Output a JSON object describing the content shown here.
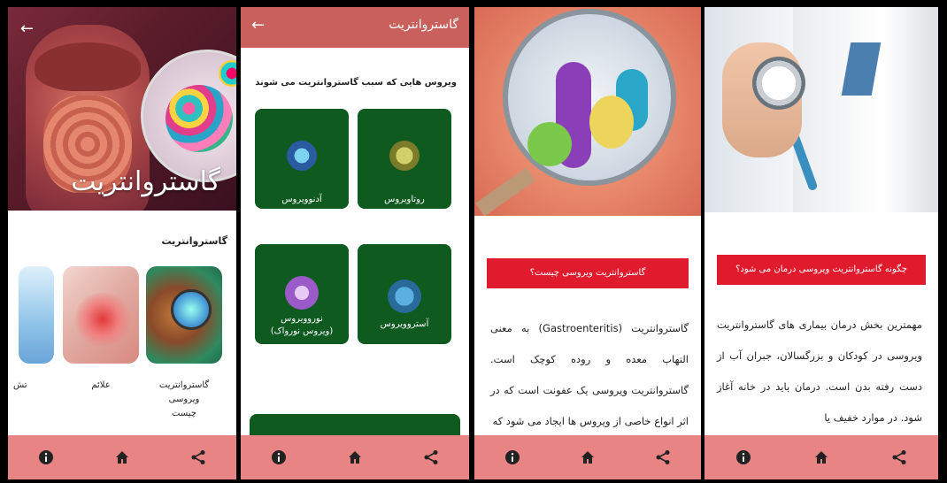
{
  "screen1": {
    "hero_title": "گاستروانتریت",
    "section_title": "گاستروانتریت",
    "cards": [
      {
        "label_line1": "گاستروانتریت ویروسی",
        "label_line2": "چیست"
      },
      {
        "label_line1": "علائم",
        "label_line2": ""
      },
      {
        "label_line1": "تش",
        "label_line2": ""
      }
    ]
  },
  "screen2": {
    "title": "گاستروانتریت",
    "subtitle": "ویروس هایی که سبب گاستروانتریت می شوند",
    "viruses": [
      {
        "label": "روتاویروس"
      },
      {
        "label": "آدنوویروس"
      },
      {
        "label": "آستروویروس"
      },
      {
        "label_line1": "نوروویروس",
        "label_line2": "(ویروس نورواک)"
      }
    ]
  },
  "screen3": {
    "heading": "گاستروانتریت ویروسی چیست؟",
    "paragraph": "گاستروانتریت (Gastroenteritis) به معنی التهاب معده و روده کوچک است. گاستروانتریت ویروسی یک عفونت است که در اثر انواع خاصی از ویروس ها ایجاد می شود که"
  },
  "screen4": {
    "heading": "چگونه گاستروانتریت ویروسی درمان می شود؟",
    "paragraph": "مهمترین بخش درمان بیماری های گاستروانتریت ویروسی در کودکان و بزرگسالان، جبران آب از دست رفته بدن است. درمان باید در خانه آغاز شود. در موارد خفیف یا"
  },
  "nav": {
    "info_icon": "info-icon",
    "home_icon": "home-icon",
    "share_icon": "share-icon"
  },
  "colors": {
    "navbar": "#e88484",
    "appbar": "#c9605b",
    "card_green": "#0f5a1f",
    "red_heading": "#e01b2d"
  }
}
